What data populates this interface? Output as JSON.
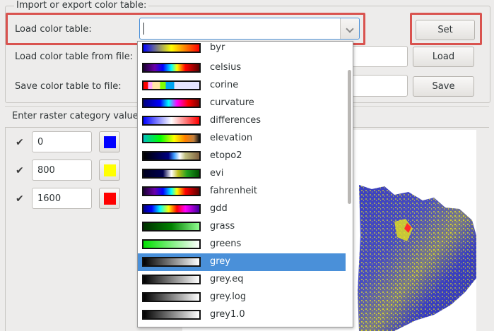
{
  "import_export": {
    "group_title": "Import or export color table:",
    "load_table_label": "Load color table:",
    "load_table_value": "",
    "set_button": "Set",
    "load_from_file_label": "Load color table from file:",
    "load_button": "Load",
    "save_to_file_label": "Save color table to file:",
    "save_button": "Save"
  },
  "categories": {
    "label": "Enter raster category value",
    "rows": [
      {
        "value": "0",
        "checked": true,
        "color": "#0000ff"
      },
      {
        "value": "800",
        "checked": true,
        "color": "#ffff00"
      },
      {
        "value": "1600",
        "checked": true,
        "color": "#ff0000"
      }
    ]
  },
  "dropdown": {
    "selected": "grey",
    "items": [
      {
        "name": "byr",
        "ramp": "linear-gradient(90deg,#0000ff,#ffff00 50%,#ff0000)"
      },
      {
        "name": "celsius",
        "ramp": "linear-gradient(90deg,#1a0033,#6a00a8 20%,#0000ff 35%,#00ffff 50%,#ffff00 60%,#ff0000 75%,#5a0000)"
      },
      {
        "name": "corine",
        "ramp": "linear-gradient(90deg,#ff0000 0 8%,#ffa6ff 8% 16%,#ffe6a6 16% 30%,#80ff00 30% 40%,#00a6f2 40% 55%,#e6e6ff 55% 100%)"
      },
      {
        "name": "curvature",
        "ramp": "linear-gradient(90deg,#00007f,#0000ff 30%,#00ffff 45%,#ff00ff 60%,#ff0000 80%,#7f0000)"
      },
      {
        "name": "differences",
        "ramp": "linear-gradient(90deg,#0000ff,#ffffff 50%,#ff0000)"
      },
      {
        "name": "elevation",
        "ramp": "linear-gradient(90deg,#00bfbf,#00ff00 30%,#ffff00 55%,#ff7f00 75%,#bf7f3f 90%,#141414)"
      },
      {
        "name": "etopo2",
        "ramp": "linear-gradient(90deg,#000000,#000080 45%,#3f9fff 55%,#ffffff 65%,#bfbf7f 75%,#7f5f3f)"
      },
      {
        "name": "evi",
        "ramp": "linear-gradient(90deg,#00001f,#00004f 35%,#ffffff 50%,#c0c020 62%,#20a020 78%,#005000)"
      },
      {
        "name": "fahrenheit",
        "ramp": "linear-gradient(90deg,#1a0033,#6a00a8 20%,#0000ff 35%,#00ffff 50%,#ffff00 60%,#ff0000 75%,#5a0000)"
      },
      {
        "name": "gdd",
        "ramp": "linear-gradient(90deg,#000080,#0000ff 15%,#00ffff 30%,#ffff00 45%,#ff0000 60%,#ff00ff 75%,#4000a0)"
      },
      {
        "name": "grass",
        "ramp": "linear-gradient(90deg,#003000,#008000 50%,#90ff90)"
      },
      {
        "name": "greens",
        "ramp": "linear-gradient(90deg,#00e000,#ffffff)"
      },
      {
        "name": "grey",
        "ramp": "linear-gradient(90deg,#000000,#ffffff)"
      },
      {
        "name": "grey.eq",
        "ramp": "linear-gradient(90deg,#000000,#ffffff)"
      },
      {
        "name": "grey.log",
        "ramp": "linear-gradient(90deg,#000000,#ffffff)"
      },
      {
        "name": "grey1.0",
        "ramp": "linear-gradient(90deg,#000000,#ffffff)"
      }
    ]
  },
  "colors": {
    "highlight": "#4a90d9",
    "annotation": "#d9534f",
    "map_land": "#3a3fbf",
    "map_high": "#e6e21a"
  }
}
